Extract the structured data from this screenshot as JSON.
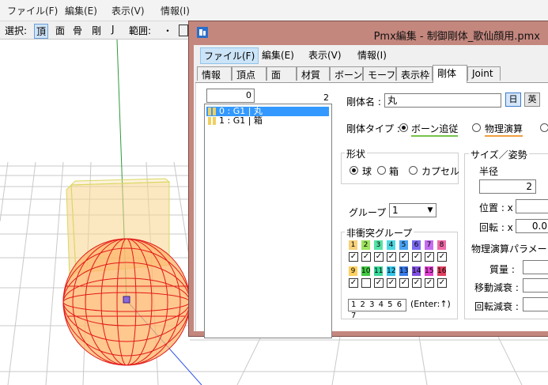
{
  "main": {
    "menu": [
      "ファイル(F)",
      "編集(E)",
      "表示(V)",
      "情報(I)"
    ],
    "toolbar": {
      "select_label": "選択:",
      "select_modes": [
        "頂",
        "面",
        "骨",
        "剛",
        "J"
      ],
      "range_label": "範囲:",
      "range_dot": "・"
    }
  },
  "dialog": {
    "title": "Pmx編集 - 制御剛体_歌仙顔用.pmx",
    "menu": [
      "ファイル(F)",
      "編集(E)",
      "表示(V)",
      "情報(I)"
    ],
    "tabs": [
      "情報",
      "頂点",
      "面",
      "材質",
      "ボーン",
      "モーフ",
      "表示枠",
      "剛体",
      "Joint"
    ],
    "active_tab": "剛体",
    "list": {
      "index_value": "0",
      "total_count": "2",
      "items": [
        {
          "label": "0 : G1 | 丸",
          "selected": true
        },
        {
          "label": "1 : G1 | 箱",
          "selected": false
        }
      ]
    },
    "body": {
      "name_label": "剛体名 :",
      "name_value": "丸",
      "lang_jp": "日",
      "lang_en": "英",
      "type_label": "剛体タイプ :",
      "type_options": [
        "ボーン追従",
        "物理演算"
      ],
      "type_selected": "ボーン追従",
      "shape_title": "形状",
      "shape_options": [
        "球",
        "箱",
        "カプセル"
      ],
      "shape_selected": "球",
      "group_label": "グループ :",
      "group_value": "1",
      "nocollide_title": "非衝突グループ",
      "group_numbers_row1": [
        "1",
        "2",
        "3",
        "4",
        "5",
        "6",
        "7",
        "8"
      ],
      "group_numbers_row2": [
        "9",
        "10",
        "11",
        "12",
        "13",
        "14",
        "15",
        "16"
      ],
      "nocollide_checks_row1": [
        true,
        true,
        true,
        true,
        true,
        true,
        true,
        true
      ],
      "nocollide_checks_row2": [
        true,
        false,
        true,
        true,
        true,
        true,
        true,
        true
      ],
      "nocollide_text": "1 2 3 4 5 6 7",
      "nocollide_hint": "(Enter:↑)",
      "size_title": "サイズ／姿勢",
      "radius_label": "半径",
      "radius_value": "2",
      "position_label": "位置 : x",
      "rotation_label": "回転 : x",
      "rotation_value": "0.0",
      "physics_title": "物理演算パラメーター",
      "mass_label": "質量 :",
      "linear_damping_label": "移動減衰 :",
      "angular_damping_label": "回転減衰 :"
    }
  },
  "colors": {
    "dialog_frame": "#c4877e",
    "selection": "#3399ff",
    "follow_underline": "#77c24a",
    "physics_underline": "#f0a040",
    "group_colors": [
      "#f7d27a",
      "#9ce35e",
      "#56e2a6",
      "#4fd6e0",
      "#4aa3f2",
      "#7b6bf0",
      "#c46cf0",
      "#ee6aa8",
      "#ffd060",
      "#43c843",
      "#38d898",
      "#34c4e8",
      "#3a7ae8",
      "#8050e0",
      "#e040d0",
      "#e04060"
    ]
  }
}
